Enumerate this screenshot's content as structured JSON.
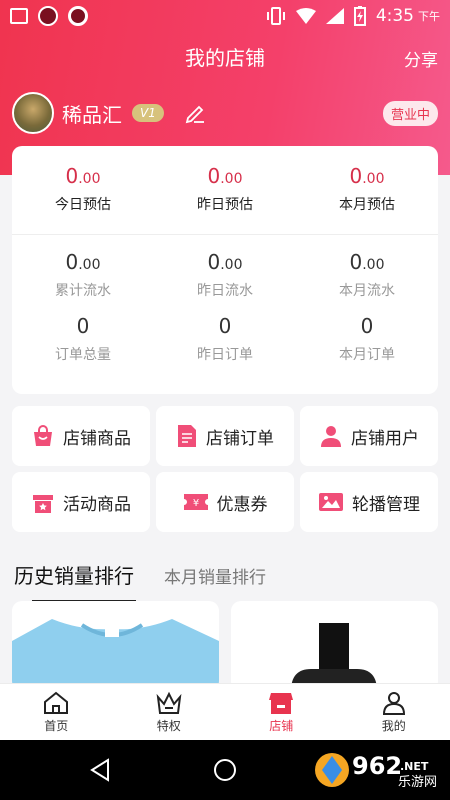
{
  "status_bar": {
    "time": "4:35",
    "ampm": "下午"
  },
  "header": {
    "title": "我的店铺",
    "share_label": "分享"
  },
  "profile": {
    "name": "稀品汇",
    "level": "V1",
    "status": "营业中"
  },
  "stats": {
    "top": [
      {
        "value": "0",
        "decimals": ".00",
        "label": "今日预估"
      },
      {
        "value": "0",
        "decimals": ".00",
        "label": "昨日预估"
      },
      {
        "value": "0",
        "decimals": ".00",
        "label": "本月预估"
      }
    ],
    "flow": [
      {
        "value": "0",
        "decimals": ".00",
        "label": "累计流水"
      },
      {
        "value": "0",
        "decimals": ".00",
        "label": "昨日流水"
      },
      {
        "value": "0",
        "decimals": ".00",
        "label": "本月流水"
      }
    ],
    "orders": [
      {
        "value": "0",
        "label": "订单总量"
      },
      {
        "value": "0",
        "label": "昨日订单"
      },
      {
        "value": "0",
        "label": "本月订单"
      }
    ]
  },
  "menu": [
    {
      "label": "店铺商品",
      "icon": "shopping-bag-icon"
    },
    {
      "label": "店铺订单",
      "icon": "document-icon"
    },
    {
      "label": "店铺用户",
      "icon": "user-icon"
    },
    {
      "label": "活动商品",
      "icon": "gift-icon"
    },
    {
      "label": "优惠券",
      "icon": "coupon-icon"
    },
    {
      "label": "轮播管理",
      "icon": "image-gallery-icon"
    }
  ],
  "tabs": {
    "history": "历史销量排行",
    "month": "本月销量排行"
  },
  "nav": [
    {
      "label": "首页",
      "icon": "home-icon"
    },
    {
      "label": "特权",
      "icon": "crown-icon"
    },
    {
      "label": "店铺",
      "icon": "shop-icon"
    },
    {
      "label": "我的",
      "icon": "person-icon"
    }
  ],
  "watermark": {
    "text": "962",
    "sub": "乐游网",
    "net": ".NET"
  },
  "colors": {
    "accent": "#e8344f",
    "gradient_end": "#f55a8c"
  }
}
